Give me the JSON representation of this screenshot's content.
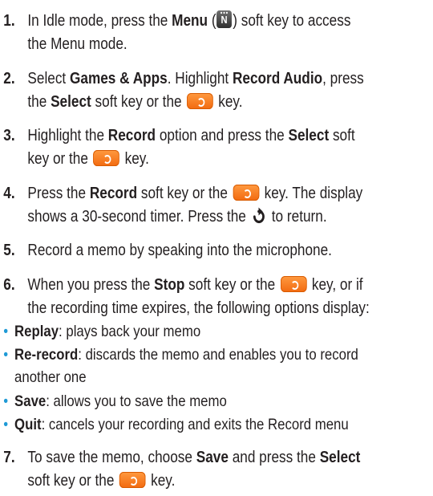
{
  "colors": {
    "bullet": "#1f9ad6",
    "key": "#f26a10",
    "text": "#231f20"
  },
  "icons": {
    "menu_key": "menu-key-icon",
    "ok_key": "ok-key-icon",
    "back_key": "back-arrow-icon"
  },
  "steps": [
    {
      "num": "1.",
      "l1": [
        "In Idle mode, press the ",
        "Menu",
        " (",
        ") soft key to access"
      ],
      "l2": "the Menu mode."
    },
    {
      "num": "2.",
      "l1": [
        "Select ",
        "Games & Apps",
        ". Highlight ",
        "Record Audio",
        ", press"
      ],
      "l2": [
        "the ",
        "Select",
        " soft key or the ",
        " key."
      ]
    },
    {
      "num": "3.",
      "l1": [
        "Highlight the ",
        "Record",
        " option and press the ",
        "Select",
        " soft"
      ],
      "l2": [
        "key or the ",
        " key."
      ]
    },
    {
      "num": "4.",
      "l1": [
        "Press the ",
        "Record",
        " soft key or the ",
        " key. The display"
      ],
      "l2": [
        "shows a 30-second timer. Press the ",
        " to return."
      ]
    },
    {
      "num": "5.",
      "l1": "Record a memo by speaking into the microphone."
    },
    {
      "num": "6.",
      "l1": [
        "When you press the ",
        "Stop",
        " soft key or the ",
        " key, or if"
      ],
      "l2": "the recording time expires, the following options display:"
    },
    {
      "num": "7.",
      "l1": [
        "To save the memo, choose ",
        "Save",
        " and press the ",
        "Select"
      ],
      "l2": [
        "soft key or the ",
        " key."
      ]
    }
  ],
  "bullets": [
    {
      "dot": "•",
      "term": "Replay",
      "desc": ": plays back your memo"
    },
    {
      "dot": "•",
      "term": "Re-record",
      "desc": ": discards the memo and enables you to record",
      "desc2": "another one"
    },
    {
      "dot": "•",
      "term": "Save",
      "desc": ": allows you to save the memo"
    },
    {
      "dot": "•",
      "term": "Quit",
      "desc": ": cancels your recording and exits the Record menu"
    }
  ]
}
